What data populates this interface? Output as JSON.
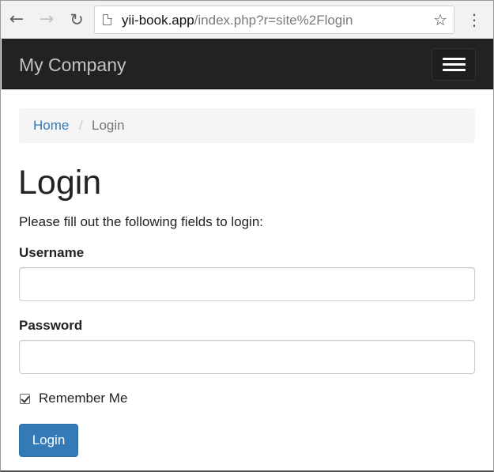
{
  "browser": {
    "url_host": "yii-book.app",
    "url_path": "/index.php?r=site%2Flogin",
    "icons": {
      "back": "arrow-left-icon",
      "forward": "arrow-right-icon",
      "reload": "reload-icon",
      "page": "page-icon",
      "bookmark": "star-icon",
      "menu": "more-vertical-icon"
    }
  },
  "navbar": {
    "brand": "My Company",
    "toggle_icon": "hamburger-menu-icon",
    "background": "#222222"
  },
  "breadcrumb": {
    "items": [
      {
        "label": "Home"
      },
      {
        "label": "Login"
      }
    ],
    "separator": "/"
  },
  "page": {
    "title": "Login",
    "intro": "Please fill out the following fields to login:"
  },
  "form": {
    "username_label": "Username",
    "username_value": "",
    "password_label": "Password",
    "password_value": "",
    "remember_label": "Remember Me",
    "remember_checked": true,
    "submit_label": "Login",
    "submit_color": "#337ab7",
    "link_color": "#337ab7"
  }
}
